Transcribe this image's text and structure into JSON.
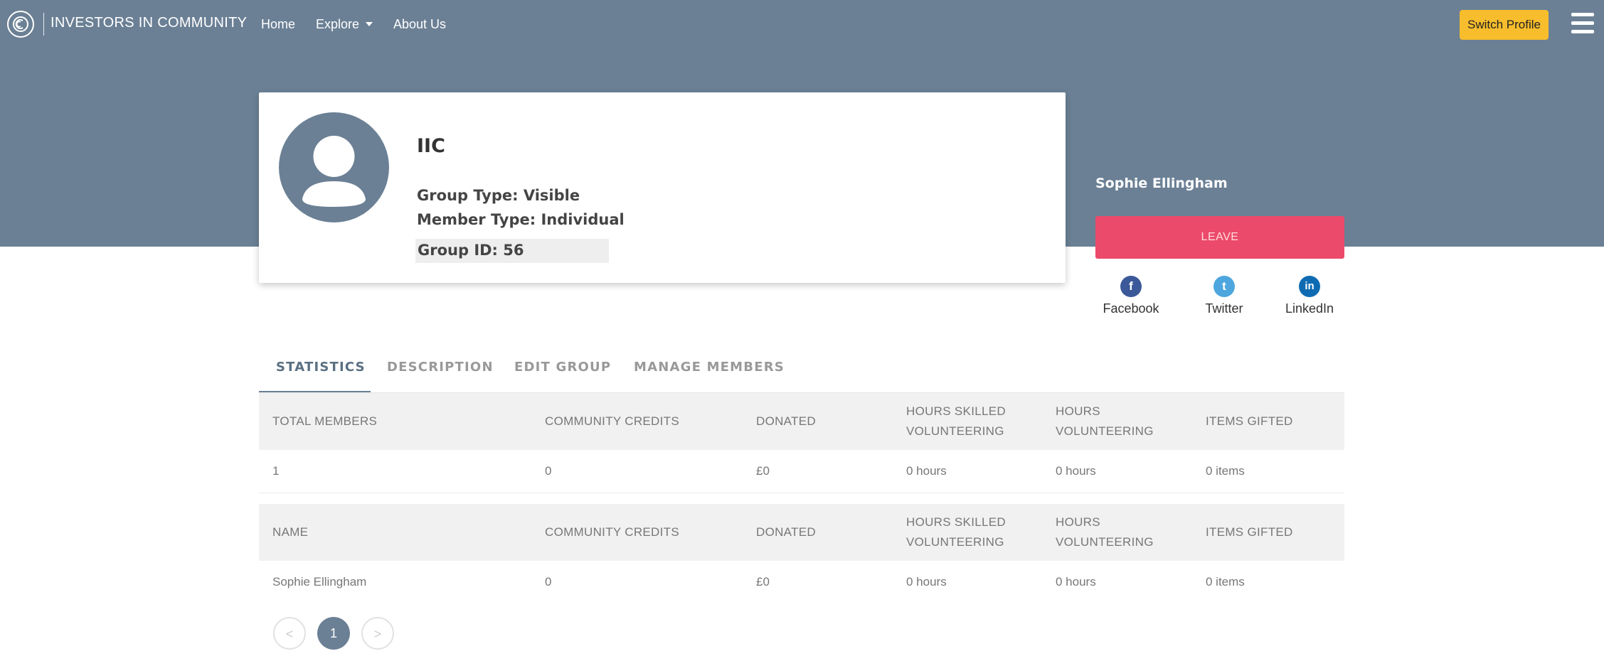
{
  "header": {
    "brand": "INVESTORS IN COMMUNITY",
    "nav": [
      {
        "label": "Home"
      },
      {
        "label": "Explore"
      },
      {
        "label": "About Us"
      }
    ],
    "switch_profile": "Switch Profile"
  },
  "group": {
    "name": "IIC",
    "group_type": "Group Type: Visible",
    "member_type": "Member Type: Individual",
    "group_id": "Group ID: 56"
  },
  "owner": {
    "name": "Sophie Ellingham",
    "leave_label": "LEAVE"
  },
  "social": [
    {
      "label": "Facebook",
      "icon": "facebook-icon",
      "glyph": "f",
      "color": "#3b5998"
    },
    {
      "label": "Twitter",
      "icon": "twitter-icon",
      "glyph": "t",
      "color": "#4da7de"
    },
    {
      "label": "LinkedIn",
      "icon": "linkedin-icon",
      "glyph": "in",
      "color": "#0e6bb2"
    }
  ],
  "tabs": [
    {
      "label": "STATISTICS",
      "active": true
    },
    {
      "label": "DESCRIPTION"
    },
    {
      "label": "EDIT GROUP"
    },
    {
      "label": "MANAGE MEMBERS"
    }
  ],
  "stats_table": {
    "headers": [
      "TOTAL MEMBERS",
      "COMMUNITY CREDITS",
      "DONATED",
      [
        "HOURS SKILLED",
        "VOLUNTEERING"
      ],
      [
        "HOURS",
        "VOLUNTEERING"
      ],
      "ITEMS GIFTED"
    ],
    "rows": [
      [
        "1",
        "0",
        "£0",
        "0 hours",
        "0 hours",
        "0 items"
      ]
    ]
  },
  "members_table": {
    "headers": [
      "NAME",
      "COMMUNITY CREDITS",
      "DONATED",
      [
        "HOURS SKILLED",
        "VOLUNTEERING"
      ],
      [
        "HOURS",
        "VOLUNTEERING"
      ],
      "ITEMS GIFTED"
    ],
    "rows": [
      [
        "Sophie Ellingham",
        "0",
        "£0",
        "0 hours",
        "0 hours",
        "0 items"
      ]
    ]
  },
  "pagination": {
    "prev": "<",
    "current": "1",
    "next": ">"
  },
  "colors": {
    "hero": "#6b8095",
    "accent_button": "#f7bd2c",
    "leave_button": "#ec4a6b"
  }
}
